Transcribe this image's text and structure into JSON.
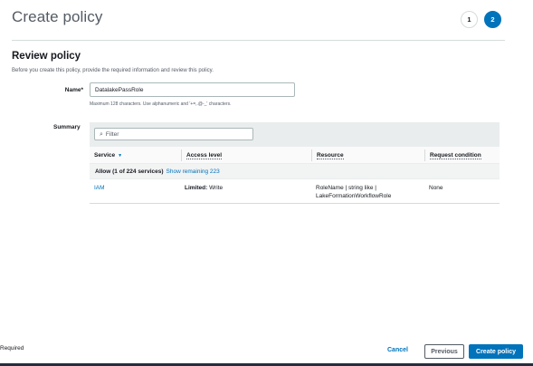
{
  "page": {
    "title": "Create policy"
  },
  "steps": [
    "1",
    "2"
  ],
  "review": {
    "title": "Review policy",
    "description": "Before you create this policy, provide the required information and review this policy."
  },
  "name_field": {
    "label": "Name*",
    "value": "DatalakePassRole",
    "hint": "Maximum 128 characters. Use alphanumeric and '+=,.@-_' characters."
  },
  "summary": {
    "label": "Summary",
    "filter_placeholder": "Filter",
    "columns": [
      "Service",
      "Access level",
      "Resource",
      "Request condition"
    ],
    "group": {
      "text": "Allow (1 of 224 services)",
      "link": "Show remaining 223"
    },
    "rows": [
      {
        "service": "IAM",
        "access_level_strong": "Limited:",
        "access_level_rest": " Write",
        "resource_line1": "RoleName | string like |",
        "resource_line2": "LakeFormationWorkflowRole",
        "request_condition": "None"
      }
    ]
  },
  "footer": {
    "required_note": "Required",
    "cancel_label": "Cancel",
    "previous_label": "Previous",
    "create_label": "Create policy"
  },
  "colors": {
    "accent": "#0073bb",
    "header_bg": "#eaeded",
    "text": "#16191f",
    "muted": "#545b64"
  },
  "icons": {
    "filter": "search-icon",
    "sort": "caret-down-icon"
  }
}
